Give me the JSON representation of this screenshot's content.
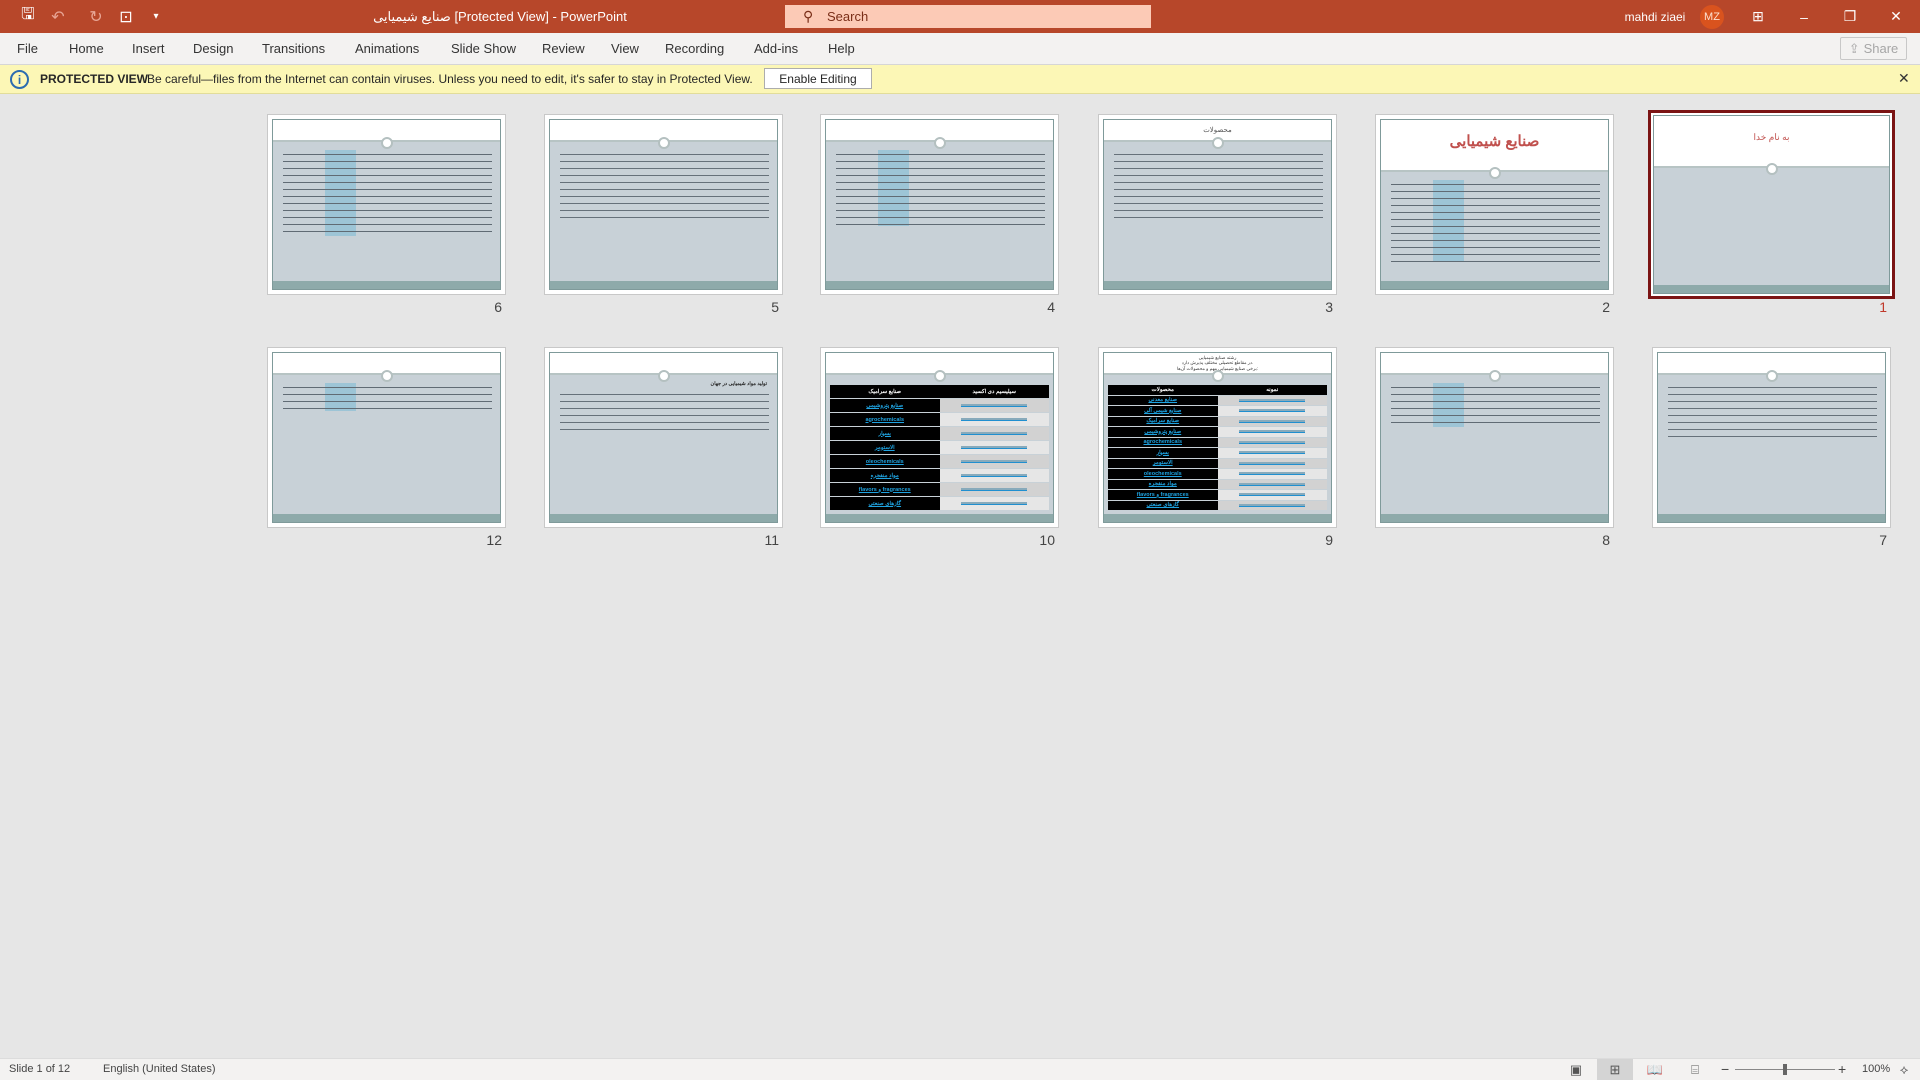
{
  "window": {
    "doc_title": "صنایع شیمیایی [Protected View]  -  PowerPoint",
    "search_placeholder": "Search",
    "user_name": "mahdi ziaei",
    "user_initials": "MZ",
    "accent": "#b7472a"
  },
  "quick_access": [
    "save-icon",
    "undo-icon",
    "redo-icon",
    "present-from-start-icon",
    "customize-icon"
  ],
  "ribbon": {
    "tabs": [
      "File",
      "Home",
      "Insert",
      "Design",
      "Transitions",
      "Animations",
      "Slide Show",
      "Review",
      "View",
      "Recording",
      "Add-ins",
      "Help"
    ],
    "share_label": "Share"
  },
  "protected_view": {
    "label": "PROTECTED VIEW",
    "message": "Be careful—files from the Internet can contain viruses. Unless you need to edit, it's safer to stay in Protected View.",
    "enable_button": "Enable Editing"
  },
  "slides": [
    {
      "number": "1",
      "title": "به نام خدا",
      "selected": true,
      "layout": "title-only"
    },
    {
      "number": "2",
      "title": "صنایع شیمیایی",
      "layout": "big-title-text"
    },
    {
      "number": "3",
      "title": "محصولات",
      "layout": "text"
    },
    {
      "number": "4",
      "title": "",
      "layout": "text"
    },
    {
      "number": "5",
      "title": "",
      "layout": "text"
    },
    {
      "number": "6",
      "title": "",
      "layout": "text"
    },
    {
      "number": "7",
      "title": "",
      "layout": "text"
    },
    {
      "number": "8",
      "title": "",
      "layout": "text"
    },
    {
      "number": "9",
      "title_lines": [
        "رشته صنایع شیمیایی",
        "در مقاطع تحصیلی مختلف پذیرش دارد.",
        "برخی صنایع شیمیایی مهم و محصولات آن‌ها:"
      ],
      "layout": "table",
      "table_header": [
        "نمونه",
        "محصولات"
      ],
      "table_rows": [
        "صنایع معدنی",
        "صنایع شیمی آلی",
        "صنایع سرامیک",
        "صنایع پتروشیمی",
        "agrochemicals",
        "بسپار",
        "الاستومر",
        "oleochemicals",
        "مواد منفجره",
        "flavors و fragrances",
        "گازهای صنعتی"
      ]
    },
    {
      "number": "10",
      "title": "",
      "layout": "table",
      "table_header": [
        "سیلیسیم دی اکسید",
        "صنایع سرامیک"
      ],
      "table_rows": [
        "صنایع پتروشیمی",
        "agrochemicals",
        "بسپار",
        "الاستومر",
        "oleochemicals",
        "مواد منفجره",
        "flavors و fragrances",
        "گازهای صنعتی"
      ]
    },
    {
      "number": "11",
      "title": "",
      "body_heading": "تولید مواد شیمیایی در جهان",
      "layout": "text"
    },
    {
      "number": "12",
      "title": "",
      "layout": "text"
    }
  ],
  "status_bar": {
    "slide_indicator": "Slide 1 of 12",
    "language": "English (United States)",
    "zoom": "100%",
    "zoom_minus": "−",
    "zoom_plus": "+"
  }
}
